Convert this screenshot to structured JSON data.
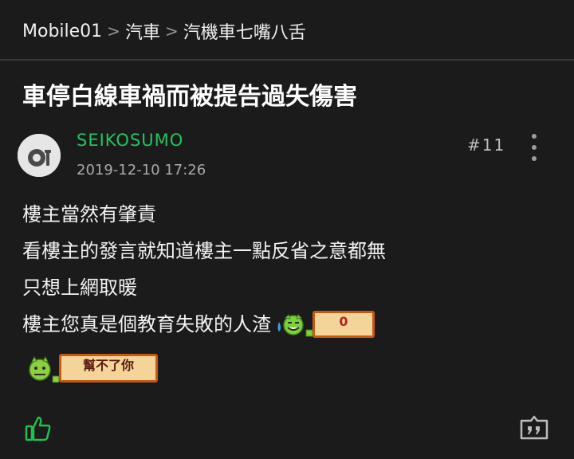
{
  "breadcrumb": {
    "items": [
      "Mobile01",
      "汽車",
      "汽機車七嘴八舌"
    ],
    "separator": ">"
  },
  "thread": {
    "title": "車停白線車禍而被提告過失傷害"
  },
  "post": {
    "username": "SEIKOSUMO",
    "timestamp": "2019-12-10 17:26",
    "floor": "#11",
    "lines": [
      "樓主當然有肇責",
      "看樓主的發言就知道樓主一點反省之意都無",
      "只想上網取暖",
      "樓主您真是個教育失敗的人渣"
    ],
    "stickers": [
      {
        "icon": "sweating-face-icon",
        "tag_text": "0"
      },
      {
        "icon": "sick-face-icon",
        "tag_text": "幫不了你"
      }
    ]
  },
  "actions": {
    "like_icon": "thumbs-up-icon",
    "quote_icon": "quote-icon"
  },
  "colors": {
    "background": "#1b1b1b",
    "username": "#22c55e",
    "accent_green": "#1fbf4a"
  }
}
